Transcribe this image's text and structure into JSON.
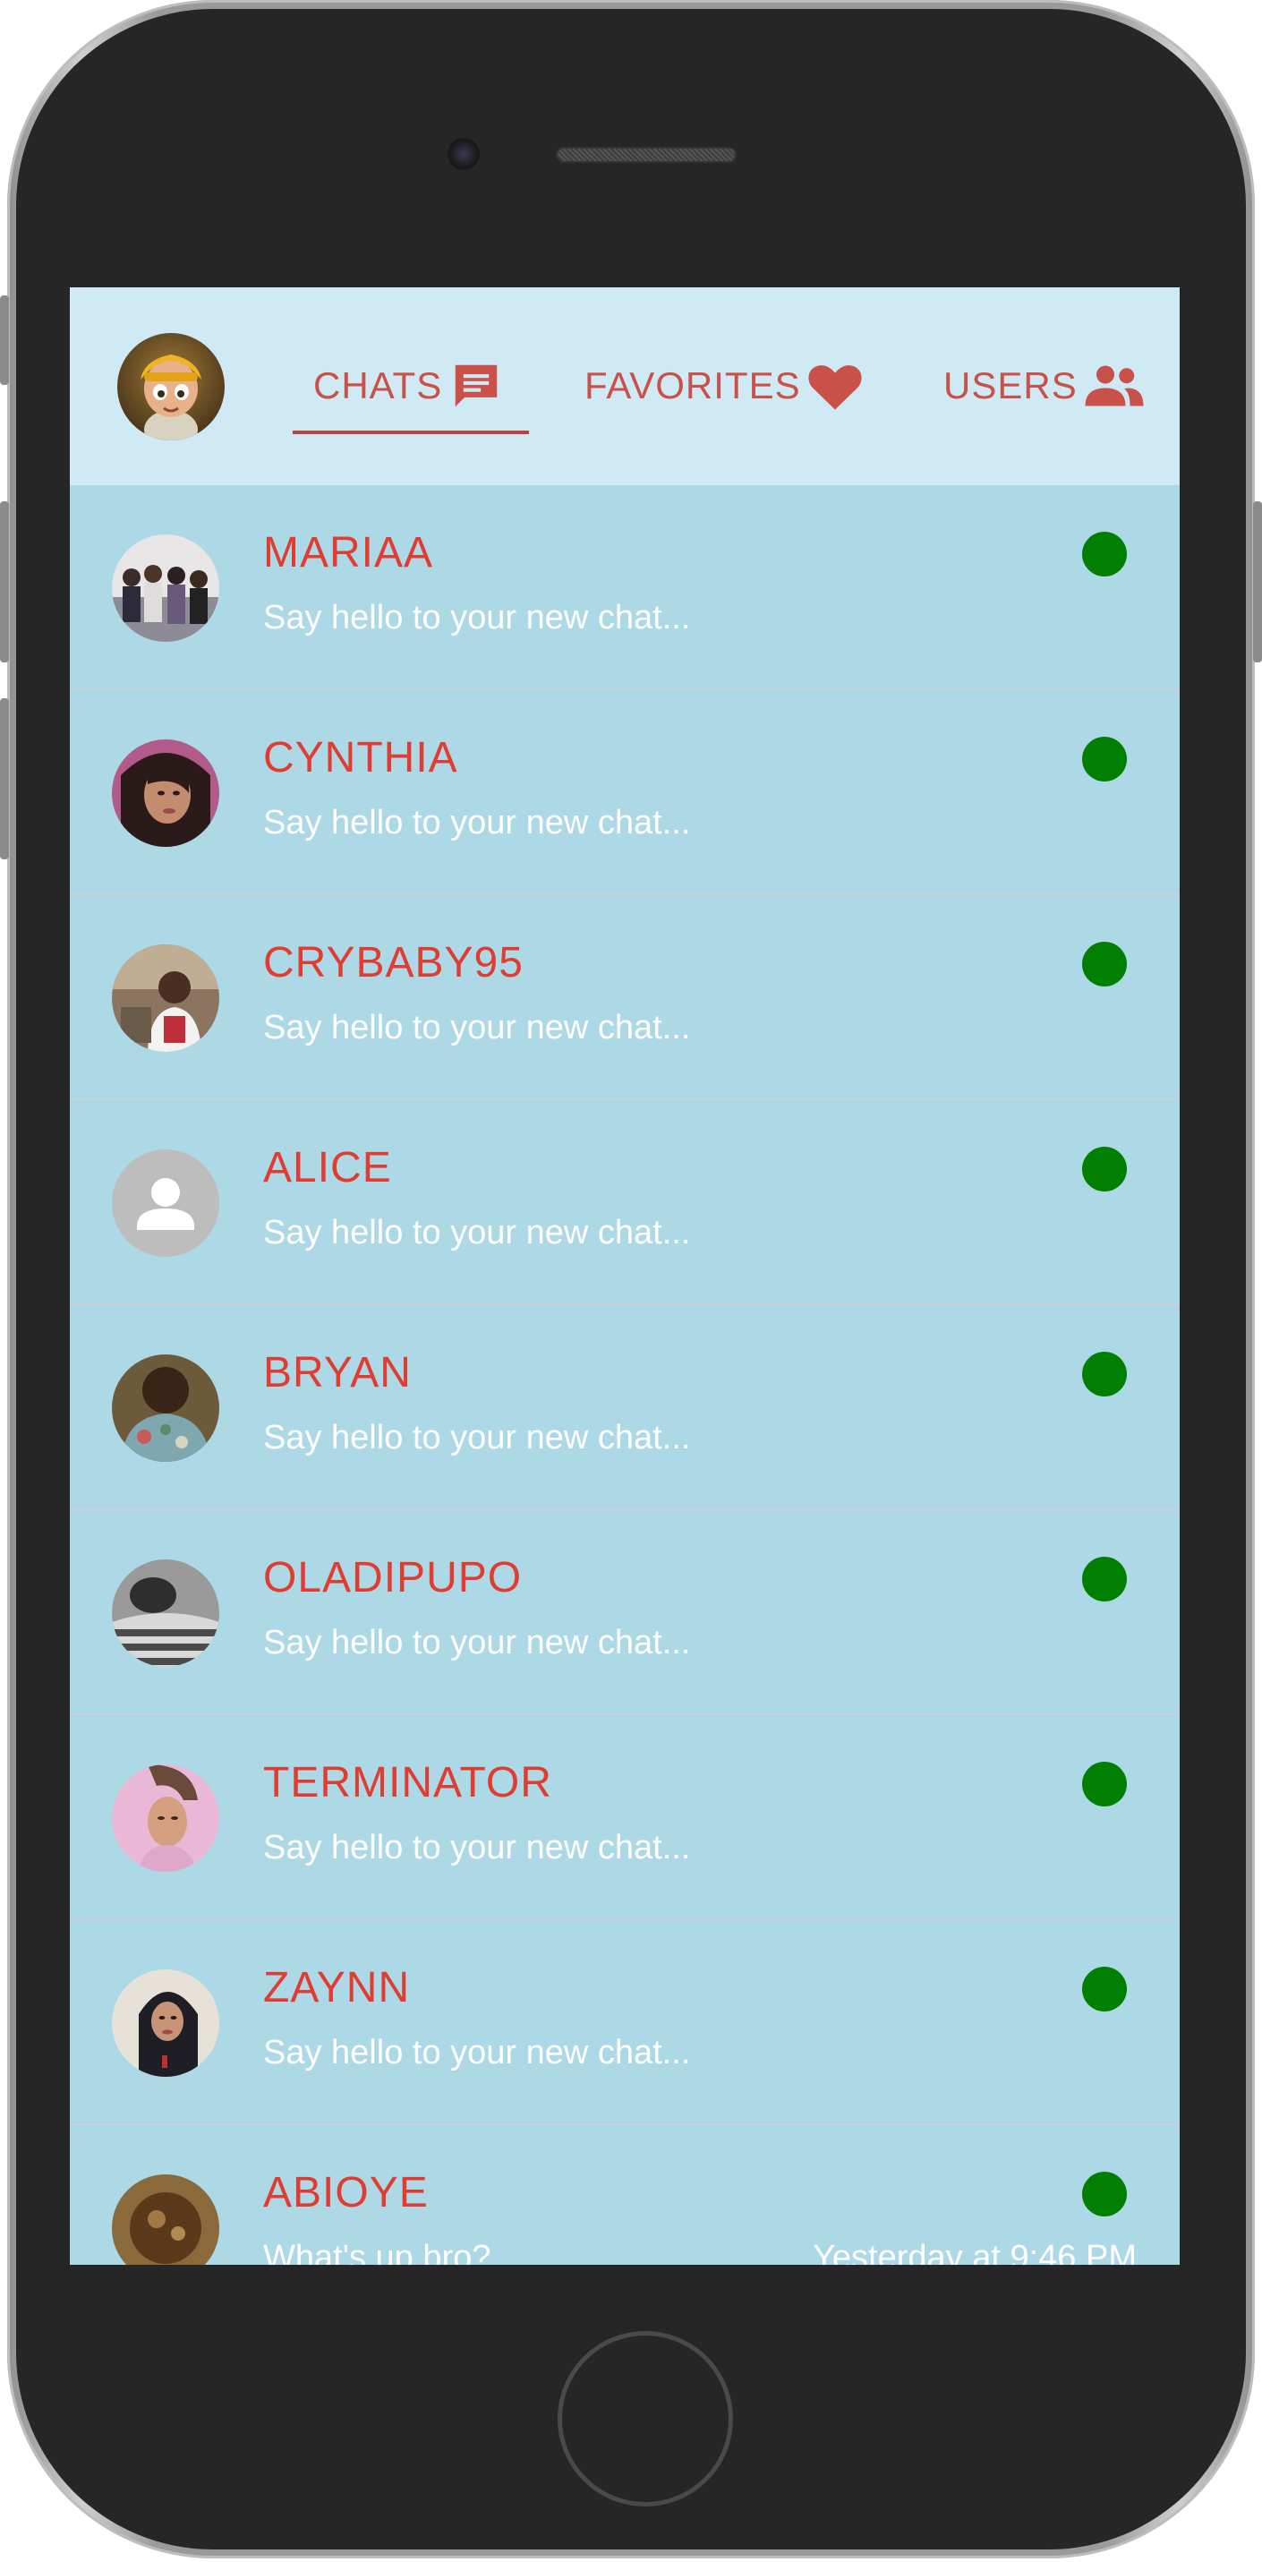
{
  "header": {
    "tabs": [
      {
        "label": "CHATS",
        "icon": "chat-bubble-icon",
        "active": true
      },
      {
        "label": "FAVORITES",
        "icon": "heart-icon",
        "active": false
      },
      {
        "label": "USERS",
        "icon": "users-icon",
        "active": false
      }
    ]
  },
  "colors": {
    "header_bg": "#cfeaf4",
    "list_bg": "#add8e6",
    "tab_text": "#c9514a",
    "name_text": "#e03c31",
    "online": "#007f00"
  },
  "chats": [
    {
      "name": "MARIAA",
      "preview": "Say hello to your new chat...",
      "time": "",
      "online": true
    },
    {
      "name": "CYNTHIA",
      "preview": "Say hello to your new chat...",
      "time": "",
      "online": true
    },
    {
      "name": "CRYBABY95",
      "preview": "Say hello to your new chat...",
      "time": "",
      "online": true
    },
    {
      "name": "ALICE",
      "preview": "Say hello to your new chat...",
      "time": "",
      "online": true
    },
    {
      "name": "BRYAN",
      "preview": "Say hello to your new chat...",
      "time": "",
      "online": true
    },
    {
      "name": "OLADIPUPO",
      "preview": "Say hello to your new chat...",
      "time": "",
      "online": true
    },
    {
      "name": "TERMINATOR",
      "preview": "Say hello to your new chat...",
      "time": "",
      "online": true
    },
    {
      "name": "ZAYNN",
      "preview": "Say hello to your new chat...",
      "time": "",
      "online": true
    },
    {
      "name": "ABIOYE",
      "preview": "What's up bro?",
      "time": "Yesterday at 9:46 PM",
      "online": true
    }
  ]
}
